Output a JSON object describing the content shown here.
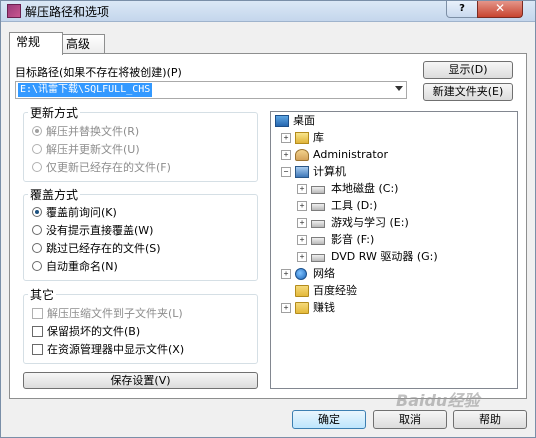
{
  "window": {
    "title": "解压路径和选项",
    "help": "?",
    "close": "✕"
  },
  "tabs": [
    {
      "label": "常规"
    },
    {
      "label": "高级"
    }
  ],
  "destination": {
    "label": "目标路径(如果不存在将被创建)(P)",
    "value": "E:\\讯雷下载\\SQLFULL_CHS",
    "show_button": "显示(D)",
    "new_folder_button": "新建文件夹(E)"
  },
  "update_mode": {
    "title": "更新方式",
    "options": [
      {
        "label": "解压并替换文件(R)",
        "checked": true
      },
      {
        "label": "解压并更新文件(U)",
        "checked": false
      },
      {
        "label": "仅更新已经存在的文件(F)",
        "checked": false
      }
    ]
  },
  "overwrite_mode": {
    "title": "覆盖方式",
    "options": [
      {
        "label": "覆盖前询问(K)",
        "checked": true
      },
      {
        "label": "没有提示直接覆盖(W)",
        "checked": false
      },
      {
        "label": "跳过已经存在的文件(S)",
        "checked": false
      },
      {
        "label": "自动重命名(N)",
        "checked": false
      }
    ]
  },
  "misc": {
    "title": "其它",
    "options": [
      {
        "label": "解压压缩文件到子文件夹(L)",
        "checked": false
      },
      {
        "label": "保留损坏的文件(B)",
        "checked": false
      },
      {
        "label": "在资源管理器中显示文件(X)",
        "checked": false
      }
    ]
  },
  "save_settings_button": "保存设置(V)",
  "tree": [
    {
      "label": "桌面",
      "icon": "desktop-icon",
      "expander": ""
    },
    {
      "label": "库",
      "icon": "library-icon",
      "expander": "+"
    },
    {
      "label": "Administrator",
      "icon": "user-folder-icon",
      "expander": "+"
    },
    {
      "label": "计算机",
      "icon": "computer-icon",
      "expander": "−"
    },
    {
      "label": "本地磁盘 (C:)",
      "icon": "drive-icon",
      "expander": "+"
    },
    {
      "label": "工具 (D:)",
      "icon": "drive-icon",
      "expander": "+"
    },
    {
      "label": "游戏与学习 (E:)",
      "icon": "drive-icon",
      "expander": "+"
    },
    {
      "label": "影音 (F:)",
      "icon": "drive-icon",
      "expander": "+"
    },
    {
      "label": "DVD RW 驱动器 (G:)",
      "icon": "dvd-drive-icon",
      "expander": "+"
    },
    {
      "label": "网络",
      "icon": "network-icon",
      "expander": "+"
    },
    {
      "label": "百度经验",
      "icon": "folder-icon",
      "expander": ""
    },
    {
      "label": "赚钱",
      "icon": "folder-icon",
      "expander": "+"
    }
  ],
  "buttons": {
    "ok": "确定",
    "cancel": "取消",
    "help": "帮助"
  },
  "watermark": "Baidu经验"
}
